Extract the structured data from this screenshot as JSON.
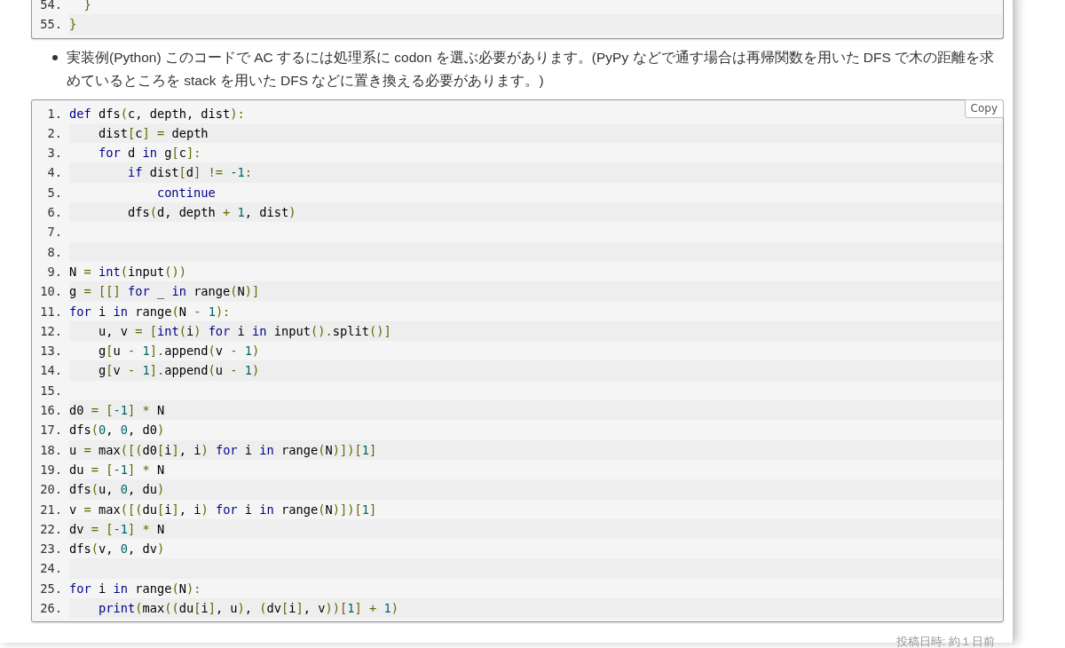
{
  "previous_code_block": {
    "lines": [
      {
        "number": "54.",
        "tokens": [
          {
            "kind": "punctuation",
            "text": "  }"
          }
        ]
      },
      {
        "number": "55.",
        "tokens": [
          {
            "kind": "punctuation",
            "text": "}"
          }
        ]
      }
    ]
  },
  "bullet": "実装例(Python) このコードで AC するには処理系に codon を選ぶ必要があります。(PyPy などで通す場合は再帰関数を用いた DFS で木の距離を求めているところを stack を用いた DFS などに置き換える必要があります。)",
  "code_block": {
    "copy_button": "Copy",
    "lines": [
      {
        "number": "1.",
        "tokens": [
          {
            "kind": "keyword",
            "text": "def"
          },
          {
            "kind": "plain",
            "text": " dfs"
          },
          {
            "kind": "punctuation",
            "text": "("
          },
          {
            "kind": "plain",
            "text": "c, depth, dist"
          },
          {
            "kind": "punctuation",
            "text": "):"
          }
        ]
      },
      {
        "number": "2.",
        "tokens": [
          {
            "kind": "plain",
            "text": "    dist"
          },
          {
            "kind": "punctuation",
            "text": "["
          },
          {
            "kind": "plain",
            "text": "c"
          },
          {
            "kind": "punctuation",
            "text": "] ="
          },
          {
            "kind": "plain",
            "text": " depth"
          }
        ]
      },
      {
        "number": "3.",
        "tokens": [
          {
            "kind": "keyword",
            "text": "    for"
          },
          {
            "kind": "plain",
            "text": " d "
          },
          {
            "kind": "keyword",
            "text": "in"
          },
          {
            "kind": "plain",
            "text": " g"
          },
          {
            "kind": "punctuation",
            "text": "["
          },
          {
            "kind": "plain",
            "text": "c"
          },
          {
            "kind": "punctuation",
            "text": "]:"
          }
        ]
      },
      {
        "number": "4.",
        "tokens": [
          {
            "kind": "keyword",
            "text": "        if"
          },
          {
            "kind": "plain",
            "text": " dist"
          },
          {
            "kind": "punctuation",
            "text": "["
          },
          {
            "kind": "plain",
            "text": "d"
          },
          {
            "kind": "punctuation",
            "text": "] != "
          },
          {
            "kind": "number",
            "text": "-1"
          },
          {
            "kind": "punctuation",
            "text": ":"
          }
        ]
      },
      {
        "number": "5.",
        "tokens": [
          {
            "kind": "keyword",
            "text": "            continue"
          }
        ]
      },
      {
        "number": "6.",
        "tokens": [
          {
            "kind": "plain",
            "text": "        dfs"
          },
          {
            "kind": "punctuation",
            "text": "("
          },
          {
            "kind": "plain",
            "text": "d, depth "
          },
          {
            "kind": "punctuation",
            "text": "+ "
          },
          {
            "kind": "number",
            "text": "1"
          },
          {
            "kind": "plain",
            "text": ", dist"
          },
          {
            "kind": "punctuation",
            "text": ")"
          }
        ]
      },
      {
        "number": "7."
      },
      {
        "number": "8."
      },
      {
        "number": "9.",
        "tokens": [
          {
            "kind": "plain",
            "text": "N "
          },
          {
            "kind": "punctuation",
            "text": "= "
          },
          {
            "kind": "keyword",
            "text": "int"
          },
          {
            "kind": "punctuation",
            "text": "("
          },
          {
            "kind": "plain",
            "text": "input"
          },
          {
            "kind": "punctuation",
            "text": "())"
          }
        ]
      },
      {
        "number": "10.",
        "tokens": [
          {
            "kind": "plain",
            "text": "g "
          },
          {
            "kind": "punctuation",
            "text": "= [[] "
          },
          {
            "kind": "keyword",
            "text": "for"
          },
          {
            "kind": "plain",
            "text": " _ "
          },
          {
            "kind": "keyword",
            "text": "in"
          },
          {
            "kind": "plain",
            "text": " range"
          },
          {
            "kind": "punctuation",
            "text": "("
          },
          {
            "kind": "plain",
            "text": "N"
          },
          {
            "kind": "punctuation",
            "text": ")]"
          }
        ]
      },
      {
        "number": "11.",
        "tokens": [
          {
            "kind": "keyword",
            "text": "for"
          },
          {
            "kind": "plain",
            "text": " i "
          },
          {
            "kind": "keyword",
            "text": "in"
          },
          {
            "kind": "plain",
            "text": " range"
          },
          {
            "kind": "punctuation",
            "text": "("
          },
          {
            "kind": "plain",
            "text": "N "
          },
          {
            "kind": "punctuation",
            "text": "- "
          },
          {
            "kind": "number",
            "text": "1"
          },
          {
            "kind": "punctuation",
            "text": "):"
          }
        ]
      },
      {
        "number": "12.",
        "tokens": [
          {
            "kind": "plain",
            "text": "    u, v "
          },
          {
            "kind": "punctuation",
            "text": "= ["
          },
          {
            "kind": "keyword",
            "text": "int"
          },
          {
            "kind": "punctuation",
            "text": "("
          },
          {
            "kind": "plain",
            "text": "i"
          },
          {
            "kind": "punctuation",
            "text": ") "
          },
          {
            "kind": "keyword",
            "text": "for"
          },
          {
            "kind": "plain",
            "text": " i "
          },
          {
            "kind": "keyword",
            "text": "in"
          },
          {
            "kind": "plain",
            "text": " input"
          },
          {
            "kind": "punctuation",
            "text": "()."
          },
          {
            "kind": "plain",
            "text": "split"
          },
          {
            "kind": "punctuation",
            "text": "()]"
          }
        ]
      },
      {
        "number": "13.",
        "tokens": [
          {
            "kind": "plain",
            "text": "    g"
          },
          {
            "kind": "punctuation",
            "text": "["
          },
          {
            "kind": "plain",
            "text": "u "
          },
          {
            "kind": "punctuation",
            "text": "- "
          },
          {
            "kind": "number",
            "text": "1"
          },
          {
            "kind": "punctuation",
            "text": "]."
          },
          {
            "kind": "plain",
            "text": "append"
          },
          {
            "kind": "punctuation",
            "text": "("
          },
          {
            "kind": "plain",
            "text": "v "
          },
          {
            "kind": "punctuation",
            "text": "- "
          },
          {
            "kind": "number",
            "text": "1"
          },
          {
            "kind": "punctuation",
            "text": ")"
          }
        ]
      },
      {
        "number": "14.",
        "tokens": [
          {
            "kind": "plain",
            "text": "    g"
          },
          {
            "kind": "punctuation",
            "text": "["
          },
          {
            "kind": "plain",
            "text": "v "
          },
          {
            "kind": "punctuation",
            "text": "- "
          },
          {
            "kind": "number",
            "text": "1"
          },
          {
            "kind": "punctuation",
            "text": "]."
          },
          {
            "kind": "plain",
            "text": "append"
          },
          {
            "kind": "punctuation",
            "text": "("
          },
          {
            "kind": "plain",
            "text": "u "
          },
          {
            "kind": "punctuation",
            "text": "- "
          },
          {
            "kind": "number",
            "text": "1"
          },
          {
            "kind": "punctuation",
            "text": ")"
          }
        ]
      },
      {
        "number": "15."
      },
      {
        "number": "16.",
        "tokens": [
          {
            "kind": "plain",
            "text": "d0 "
          },
          {
            "kind": "punctuation",
            "text": "= ["
          },
          {
            "kind": "number",
            "text": "-1"
          },
          {
            "kind": "punctuation",
            "text": "] * "
          },
          {
            "kind": "plain",
            "text": "N"
          }
        ]
      },
      {
        "number": "17.",
        "tokens": [
          {
            "kind": "plain",
            "text": "dfs"
          },
          {
            "kind": "punctuation",
            "text": "("
          },
          {
            "kind": "number",
            "text": "0"
          },
          {
            "kind": "plain",
            "text": ", "
          },
          {
            "kind": "number",
            "text": "0"
          },
          {
            "kind": "plain",
            "text": ", d0"
          },
          {
            "kind": "punctuation",
            "text": ")"
          }
        ]
      },
      {
        "number": "18.",
        "tokens": [
          {
            "kind": "plain",
            "text": "u "
          },
          {
            "kind": "punctuation",
            "text": "= "
          },
          {
            "kind": "plain",
            "text": "max"
          },
          {
            "kind": "punctuation",
            "text": "([("
          },
          {
            "kind": "plain",
            "text": "d0"
          },
          {
            "kind": "punctuation",
            "text": "["
          },
          {
            "kind": "plain",
            "text": "i"
          },
          {
            "kind": "punctuation",
            "text": "]"
          },
          {
            "kind": "plain",
            "text": ", i"
          },
          {
            "kind": "punctuation",
            "text": ") "
          },
          {
            "kind": "keyword",
            "text": "for"
          },
          {
            "kind": "plain",
            "text": " i "
          },
          {
            "kind": "keyword",
            "text": "in"
          },
          {
            "kind": "plain",
            "text": " range"
          },
          {
            "kind": "punctuation",
            "text": "("
          },
          {
            "kind": "plain",
            "text": "N"
          },
          {
            "kind": "punctuation",
            "text": ")])["
          },
          {
            "kind": "number",
            "text": "1"
          },
          {
            "kind": "punctuation",
            "text": "]"
          }
        ]
      },
      {
        "number": "19.",
        "tokens": [
          {
            "kind": "plain",
            "text": "du "
          },
          {
            "kind": "punctuation",
            "text": "= ["
          },
          {
            "kind": "number",
            "text": "-1"
          },
          {
            "kind": "punctuation",
            "text": "] * "
          },
          {
            "kind": "plain",
            "text": "N"
          }
        ]
      },
      {
        "number": "20.",
        "tokens": [
          {
            "kind": "plain",
            "text": "dfs"
          },
          {
            "kind": "punctuation",
            "text": "("
          },
          {
            "kind": "plain",
            "text": "u, "
          },
          {
            "kind": "number",
            "text": "0"
          },
          {
            "kind": "plain",
            "text": ", du"
          },
          {
            "kind": "punctuation",
            "text": ")"
          }
        ]
      },
      {
        "number": "21.",
        "tokens": [
          {
            "kind": "plain",
            "text": "v "
          },
          {
            "kind": "punctuation",
            "text": "= "
          },
          {
            "kind": "plain",
            "text": "max"
          },
          {
            "kind": "punctuation",
            "text": "([("
          },
          {
            "kind": "plain",
            "text": "du"
          },
          {
            "kind": "punctuation",
            "text": "["
          },
          {
            "kind": "plain",
            "text": "i"
          },
          {
            "kind": "punctuation",
            "text": "]"
          },
          {
            "kind": "plain",
            "text": ", i"
          },
          {
            "kind": "punctuation",
            "text": ") "
          },
          {
            "kind": "keyword",
            "text": "for"
          },
          {
            "kind": "plain",
            "text": " i "
          },
          {
            "kind": "keyword",
            "text": "in"
          },
          {
            "kind": "plain",
            "text": " range"
          },
          {
            "kind": "punctuation",
            "text": "("
          },
          {
            "kind": "plain",
            "text": "N"
          },
          {
            "kind": "punctuation",
            "text": ")])["
          },
          {
            "kind": "number",
            "text": "1"
          },
          {
            "kind": "punctuation",
            "text": "]"
          }
        ]
      },
      {
        "number": "22.",
        "tokens": [
          {
            "kind": "plain",
            "text": "dv "
          },
          {
            "kind": "punctuation",
            "text": "= ["
          },
          {
            "kind": "number",
            "text": "-1"
          },
          {
            "kind": "punctuation",
            "text": "] * "
          },
          {
            "kind": "plain",
            "text": "N"
          }
        ]
      },
      {
        "number": "23.",
        "tokens": [
          {
            "kind": "plain",
            "text": "dfs"
          },
          {
            "kind": "punctuation",
            "text": "("
          },
          {
            "kind": "plain",
            "text": "v, "
          },
          {
            "kind": "number",
            "text": "0"
          },
          {
            "kind": "plain",
            "text": ", dv"
          },
          {
            "kind": "punctuation",
            "text": ")"
          }
        ]
      },
      {
        "number": "24."
      },
      {
        "number": "25.",
        "tokens": [
          {
            "kind": "keyword",
            "text": "for"
          },
          {
            "kind": "plain",
            "text": " i "
          },
          {
            "kind": "keyword",
            "text": "in"
          },
          {
            "kind": "plain",
            "text": " range"
          },
          {
            "kind": "punctuation",
            "text": "("
          },
          {
            "kind": "plain",
            "text": "N"
          },
          {
            "kind": "punctuation",
            "text": "):"
          }
        ]
      },
      {
        "number": "26.",
        "tokens": [
          {
            "kind": "keyword",
            "text": "    print"
          },
          {
            "kind": "punctuation",
            "text": "("
          },
          {
            "kind": "plain",
            "text": "max"
          },
          {
            "kind": "punctuation",
            "text": "(("
          },
          {
            "kind": "plain",
            "text": "du"
          },
          {
            "kind": "punctuation",
            "text": "["
          },
          {
            "kind": "plain",
            "text": "i"
          },
          {
            "kind": "punctuation",
            "text": "]"
          },
          {
            "kind": "plain",
            "text": ", u"
          },
          {
            "kind": "punctuation",
            "text": ")"
          },
          {
            "kind": "plain",
            "text": ", "
          },
          {
            "kind": "punctuation",
            "text": "("
          },
          {
            "kind": "plain",
            "text": "dv"
          },
          {
            "kind": "punctuation",
            "text": "["
          },
          {
            "kind": "plain",
            "text": "i"
          },
          {
            "kind": "punctuation",
            "text": "]"
          },
          {
            "kind": "plain",
            "text": ", v"
          },
          {
            "kind": "punctuation",
            "text": "))["
          },
          {
            "kind": "number",
            "text": "1"
          },
          {
            "kind": "punctuation",
            "text": "] + "
          },
          {
            "kind": "number",
            "text": "1"
          },
          {
            "kind": "punctuation",
            "text": ")"
          }
        ]
      }
    ]
  },
  "posted": "投稿日時: 約１日前"
}
